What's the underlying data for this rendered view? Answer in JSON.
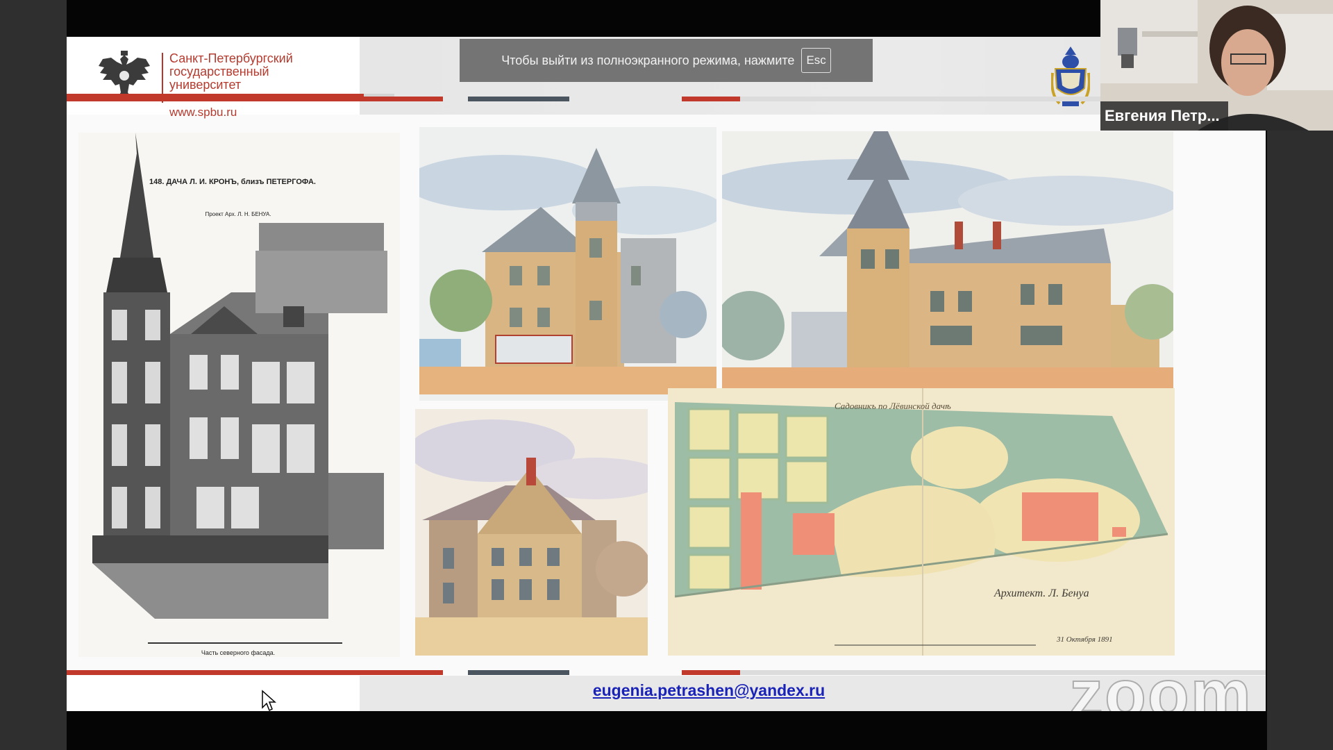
{
  "fullscreen_toast": {
    "message": "Чтобы выйти из полноэкранного режима, нажмите",
    "key": "Esc"
  },
  "slide": {
    "university_name": "Санкт-Петербургский\nгосударственный\nуниверситет",
    "university_url": "www.spbu.ru",
    "engraving_caption_title": "148. ДАЧА Л. И. КРОНЪ, близъ ПЕТЕРГОФА.",
    "engraving_caption_author": "Проект Арх. Л. Н. БЕНУА.",
    "engraving_caption_bottom": "Часть северного фасада.",
    "site_plan_title": "Садовникъ по Лёвинской дачѣ",
    "site_plan_signature": "Архитект. Л. Бенуа",
    "site_plan_date": "31 Октября 1891",
    "contact_email": "eugenia.petrashen@yandex.ru",
    "stripe_colors": [
      "#c0392b",
      "#4a5560",
      "#c0392b",
      "#d3d3d3"
    ]
  },
  "participant": {
    "name": "Евгения Петр..."
  },
  "watermark": {
    "text": "zoom"
  }
}
